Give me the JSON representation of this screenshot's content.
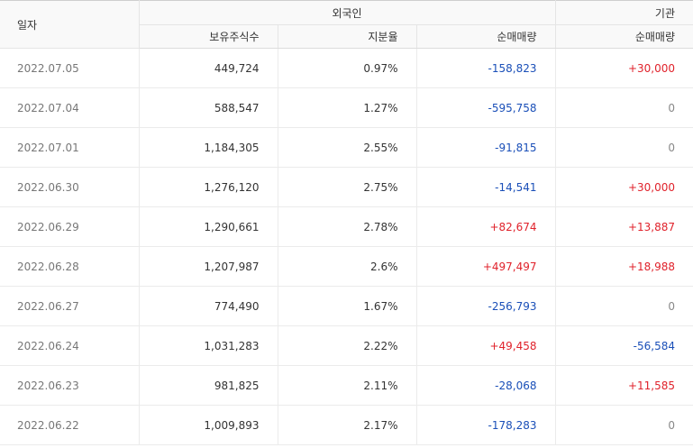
{
  "header": {
    "date_label": "일자",
    "foreign_group": "외국인",
    "institution_group": "기관",
    "holdings_label": "보유주식수",
    "ratio_label": "지분율",
    "foreign_net_label": "순매매량",
    "institution_net_label": "순매매량"
  },
  "colors": {
    "up": "#e0222b",
    "down": "#1a4fb8",
    "flat": "#888888"
  },
  "rows": [
    {
      "date": "2022.07.05",
      "holdings": "449,724",
      "ratio": "0.97%",
      "foreign_net": "-158,823",
      "institution_net": "+30,000"
    },
    {
      "date": "2022.07.04",
      "holdings": "588,547",
      "ratio": "1.27%",
      "foreign_net": "-595,758",
      "institution_net": "0"
    },
    {
      "date": "2022.07.01",
      "holdings": "1,184,305",
      "ratio": "2.55%",
      "foreign_net": "-91,815",
      "institution_net": "0"
    },
    {
      "date": "2022.06.30",
      "holdings": "1,276,120",
      "ratio": "2.75%",
      "foreign_net": "-14,541",
      "institution_net": "+30,000"
    },
    {
      "date": "2022.06.29",
      "holdings": "1,290,661",
      "ratio": "2.78%",
      "foreign_net": "+82,674",
      "institution_net": "+13,887"
    },
    {
      "date": "2022.06.28",
      "holdings": "1,207,987",
      "ratio": "2.6%",
      "foreign_net": "+497,497",
      "institution_net": "+18,988"
    },
    {
      "date": "2022.06.27",
      "holdings": "774,490",
      "ratio": "1.67%",
      "foreign_net": "-256,793",
      "institution_net": "0"
    },
    {
      "date": "2022.06.24",
      "holdings": "1,031,283",
      "ratio": "2.22%",
      "foreign_net": "+49,458",
      "institution_net": "-56,584"
    },
    {
      "date": "2022.06.23",
      "holdings": "981,825",
      "ratio": "2.11%",
      "foreign_net": "-28,068",
      "institution_net": "+11,585"
    },
    {
      "date": "2022.06.22",
      "holdings": "1,009,893",
      "ratio": "2.17%",
      "foreign_net": "-178,283",
      "institution_net": "0"
    }
  ]
}
